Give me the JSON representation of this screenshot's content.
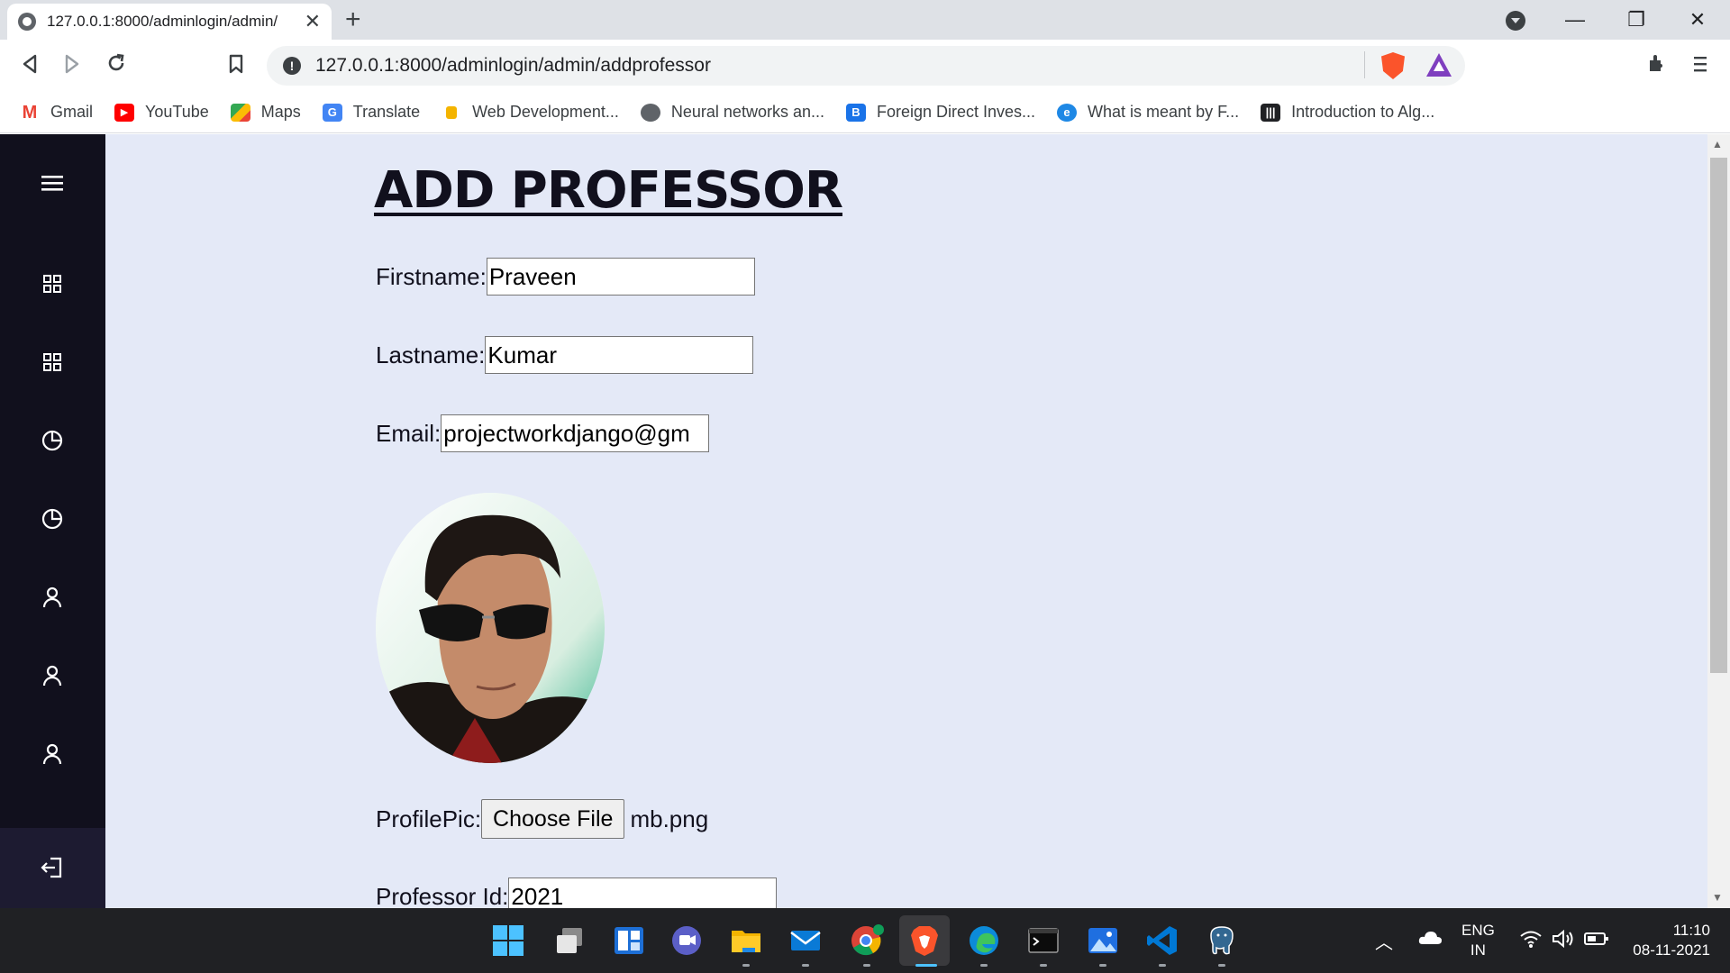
{
  "browser": {
    "tab_title": "127.0.0.1:8000/adminlogin/admin/",
    "url": "127.0.0.1:8000/adminlogin/admin/addprofessor",
    "bookmarks": [
      {
        "label": "Gmail",
        "icon": "gmail-icon",
        "color": "#ea4335"
      },
      {
        "label": "YouTube",
        "icon": "youtube-icon",
        "color": "#ff0000"
      },
      {
        "label": "Maps",
        "icon": "maps-icon",
        "color": "#34a853"
      },
      {
        "label": "Translate",
        "icon": "translate-icon",
        "color": "#4285f4"
      },
      {
        "label": "Web Development...",
        "icon": "webdev-icon",
        "color": "#f4b400"
      },
      {
        "label": "Neural networks an...",
        "icon": "globe-icon",
        "color": "#5f6368"
      },
      {
        "label": "Foreign Direct Inves...",
        "icon": "b-icon",
        "color": "#1a73e8"
      },
      {
        "label": "What is meant by F...",
        "icon": "e-icon",
        "color": "#1e88e5"
      },
      {
        "label": "Introduction to Alg...",
        "icon": "bars-icon",
        "color": "#202124"
      }
    ]
  },
  "page": {
    "title": "ADD PROFESSOR",
    "fields": {
      "firstname_label": "Firstname:",
      "firstname_value": "Praveen",
      "lastname_label": "Lastname:",
      "lastname_value": "Kumar",
      "email_label": "Email:",
      "email_value": "projectworkdjango@gm",
      "profilepic_label": "ProfilePic:",
      "choose_file_label": "Choose File",
      "file_name": "mb.png",
      "professor_id_label": "Professor Id:",
      "professor_id_value": "2021"
    },
    "sidebar_icons": [
      "menu-icon",
      "grid-icon",
      "grid-icon",
      "pie-chart-icon",
      "pie-chart-icon",
      "user-icon",
      "user-icon",
      "user-icon",
      "logout-icon"
    ]
  },
  "taskbar": {
    "language": "ENG",
    "region": "IN",
    "time": "11:10",
    "date": "08-11-2021"
  },
  "colors": {
    "sidebar_bg": "#11101d",
    "content_bg": "#e4e9f7",
    "title_color": "#11101d"
  }
}
